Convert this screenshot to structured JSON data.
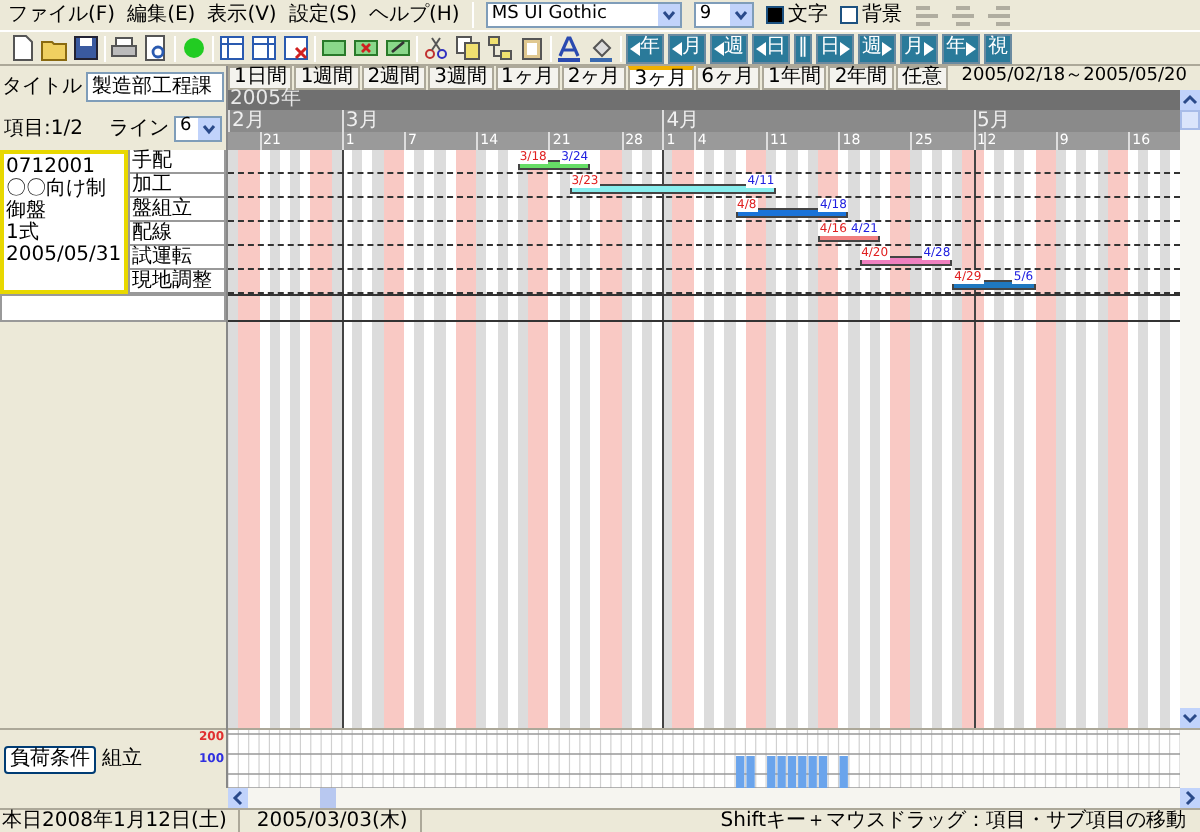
{
  "menu": [
    "ファイル(F)",
    "編集(E)",
    "表示(V)",
    "設定(S)",
    "ヘルプ(H)"
  ],
  "format_bar": {
    "font": "MS UI Gothic",
    "size": "9",
    "text_option": {
      "label": "文字",
      "checked": true
    },
    "background_option": {
      "label": "背景",
      "checked": false
    }
  },
  "nav_buttons": [
    {
      "label": "年",
      "kind": "back"
    },
    {
      "label": "月",
      "kind": "back"
    },
    {
      "label": "週",
      "kind": "back"
    },
    {
      "label": "日",
      "kind": "back"
    },
    {
      "label": "‖",
      "kind": "plain"
    },
    {
      "label": "日",
      "kind": "forward"
    },
    {
      "label": "週",
      "kind": "forward"
    },
    {
      "label": "月",
      "kind": "forward"
    },
    {
      "label": "年",
      "kind": "forward"
    },
    {
      "label": "視",
      "kind": "plain"
    }
  ],
  "title_field": {
    "label": "タイトル",
    "value": "製造部工程課"
  },
  "scale_tabs": [
    {
      "label": "1日間",
      "selected": false
    },
    {
      "label": "1週間",
      "selected": false
    },
    {
      "label": "2週間",
      "selected": false
    },
    {
      "label": "3週間",
      "selected": false
    },
    {
      "label": "1ヶ月",
      "selected": false
    },
    {
      "label": "2ヶ月",
      "selected": false
    },
    {
      "label": "3ヶ月",
      "selected": true
    },
    {
      "label": "6ヶ月",
      "selected": false
    },
    {
      "label": "1年間",
      "selected": false
    },
    {
      "label": "2年間",
      "selected": false
    },
    {
      "label": "任意",
      "selected": false
    }
  ],
  "range": "2005/02/18～2005/05/20",
  "item_counter": "項目:1/2",
  "line": {
    "label": "ライン",
    "value": "6"
  },
  "timeline": {
    "year": "2005年",
    "months": [
      "2月",
      "3月",
      "4月",
      "5月"
    ],
    "days": [
      "21",
      "1",
      "7",
      "14",
      "21",
      "28",
      "1",
      "4",
      "11",
      "18",
      "25",
      "1",
      "2",
      "9",
      "16"
    ]
  },
  "item": {
    "lines": [
      "0712001",
      "〇〇向け制御盤",
      "1式",
      "2005/05/31"
    ],
    "selected": true
  },
  "tasks": [
    {
      "name": "手配",
      "start": "3/18",
      "end": "3/24",
      "color": "#66dd66"
    },
    {
      "name": "加工",
      "start": "3/23",
      "end": "4/11",
      "color": "#88eeee"
    },
    {
      "name": "盤組立",
      "start": "4/8",
      "end": "4/18",
      "color": "#1a73d9"
    },
    {
      "name": "配線",
      "start": "4/16",
      "end": "4/21",
      "color": "#f08080"
    },
    {
      "name": "試運転",
      "start": "4/20",
      "end": "4/28",
      "color": "#f080c0"
    },
    {
      "name": "現地調整",
      "start": "4/29",
      "end": "5/6",
      "color": "#1f78c0"
    }
  ],
  "load": {
    "button": "負荷条件",
    "label": "組立",
    "upper_tick": "200",
    "lower_tick": "100"
  },
  "status_bar": [
    "本日2008年1月12日(土)",
    "2005/03/03(木)",
    "Shiftキー＋マウスドラッグ：項目・サブ項目の移動"
  ]
}
